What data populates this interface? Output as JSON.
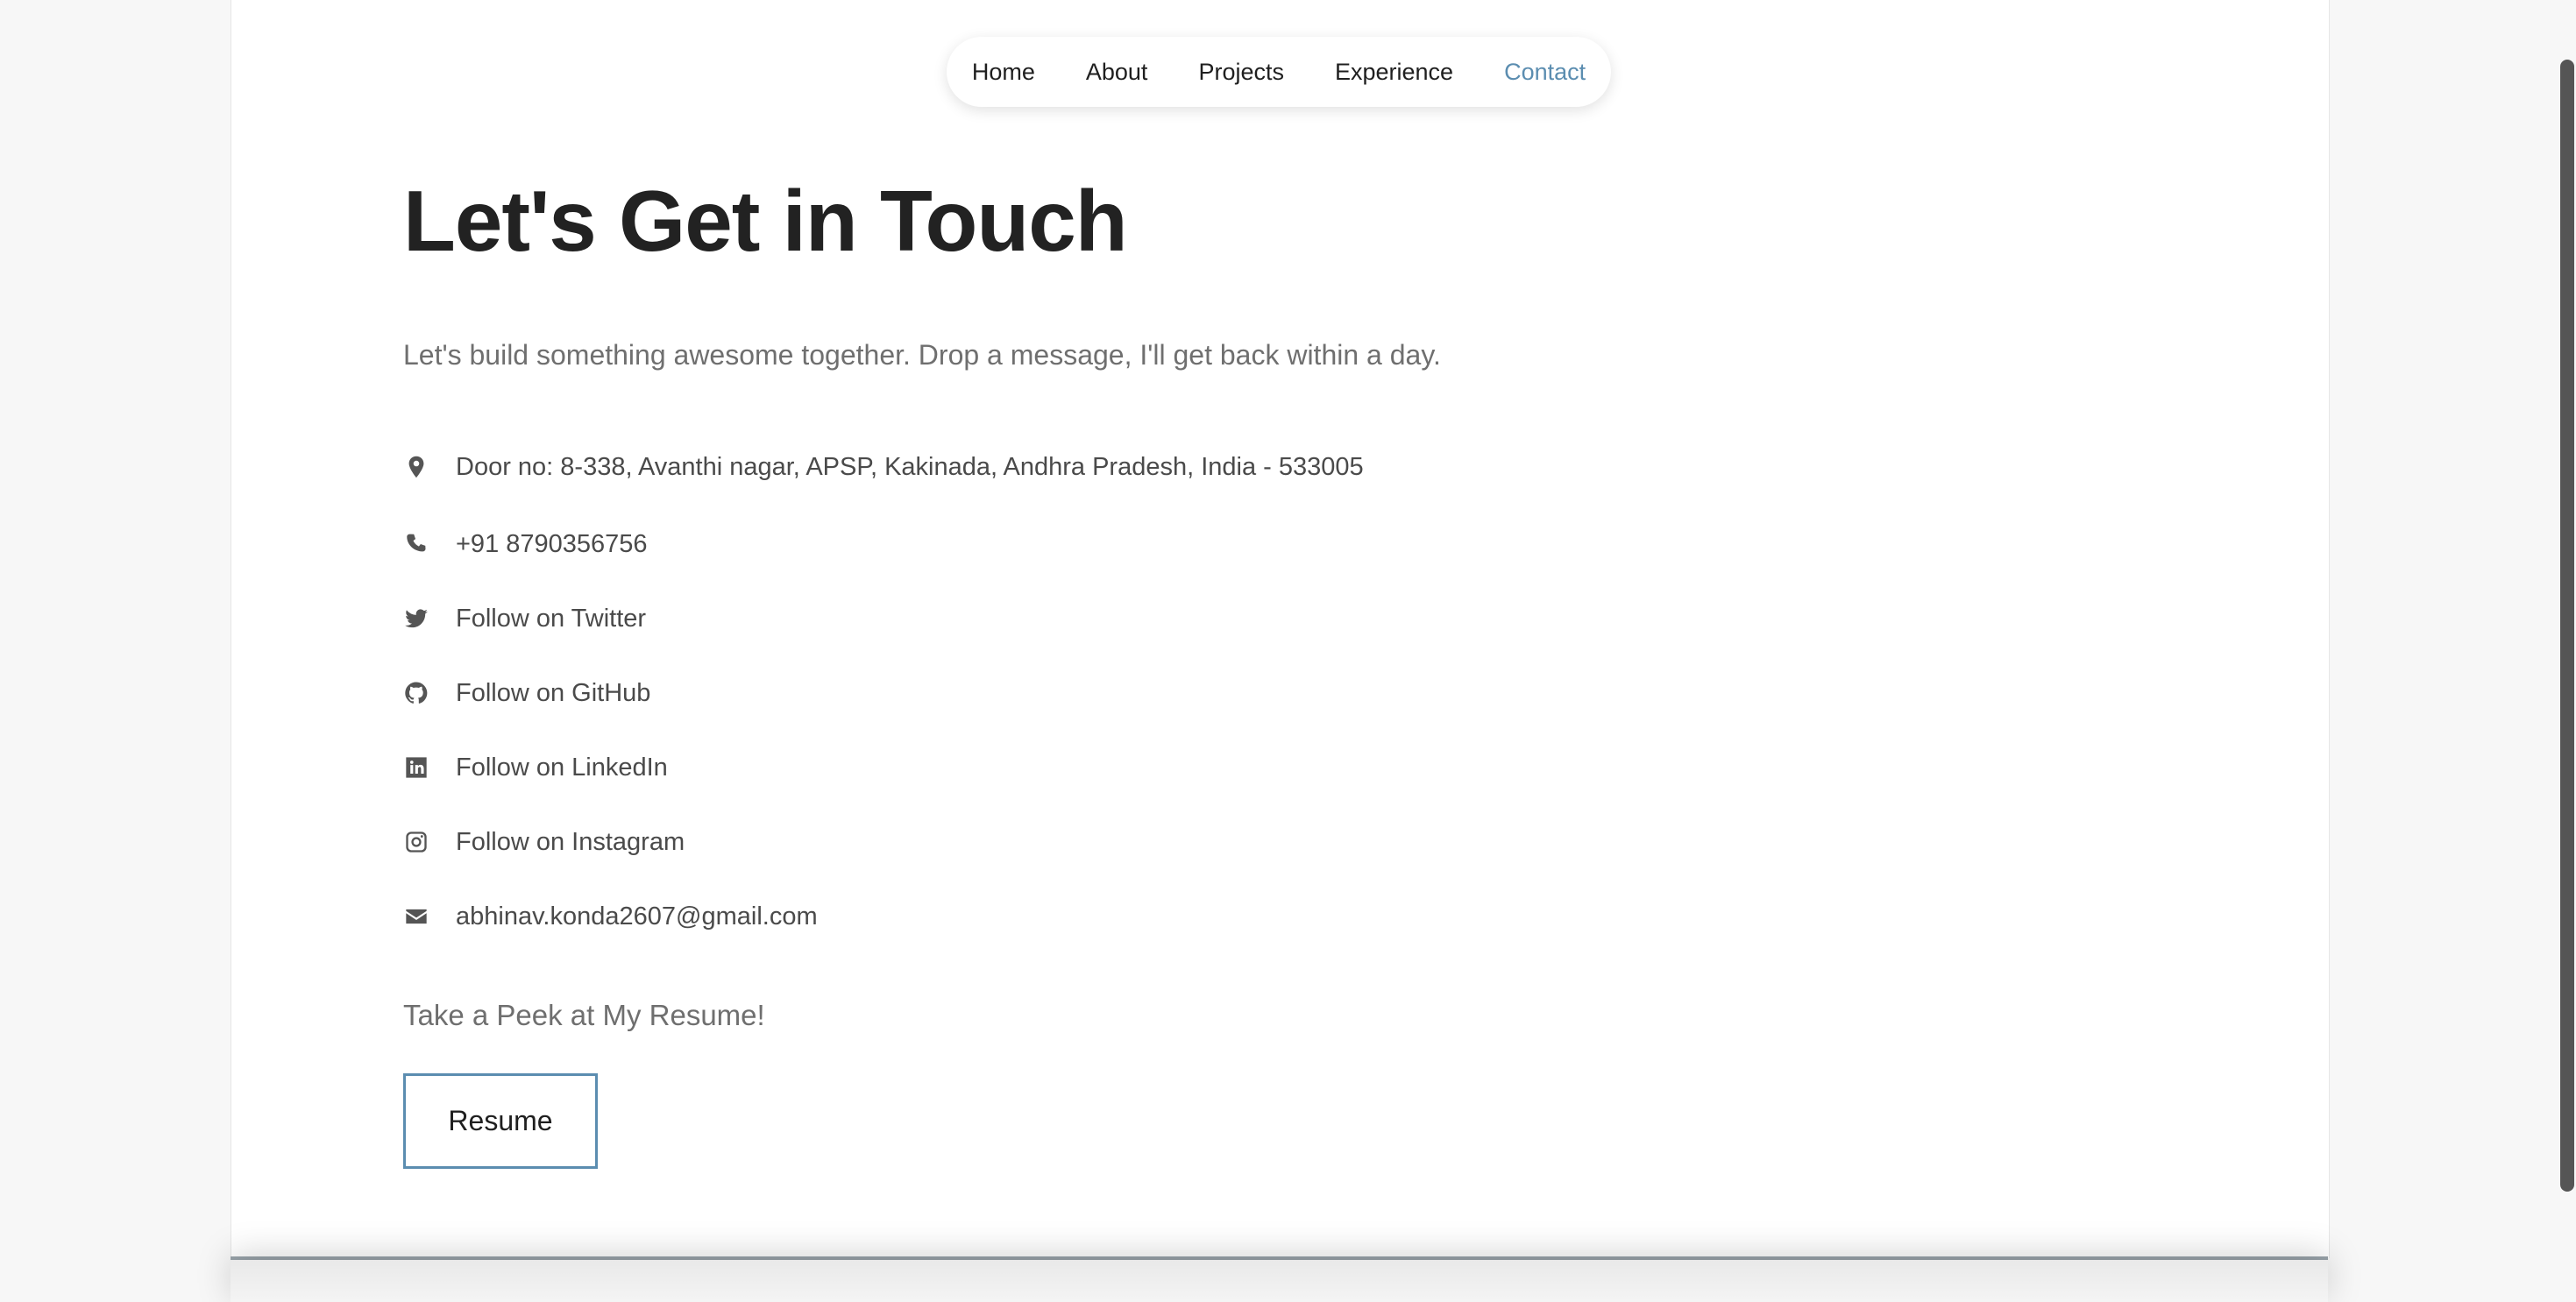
{
  "nav": {
    "items": [
      "Home",
      "About",
      "Projects",
      "Experience",
      "Contact"
    ],
    "active": "Contact"
  },
  "contact": {
    "title": "Let's Get in Touch",
    "subtitle": "Let's build something awesome together. Drop a message, I'll get back within a day.",
    "items": [
      {
        "icon": "location-pin-icon",
        "text": "Door no: 8-338, Avanthi nagar, APSP, Kakinada, Andhra Pradesh, India - 533005"
      },
      {
        "icon": "phone-icon",
        "text": "+91 8790356756"
      },
      {
        "icon": "twitter-icon",
        "text": "Follow on Twitter"
      },
      {
        "icon": "github-icon",
        "text": "Follow on GitHub"
      },
      {
        "icon": "linkedin-icon",
        "text": "Follow on LinkedIn"
      },
      {
        "icon": "instagram-icon",
        "text": "Follow on Instagram"
      },
      {
        "icon": "envelope-icon",
        "text": "abhinav.konda2607@gmail.com"
      }
    ],
    "resume_prompt": "Take a Peek at My Resume!",
    "resume_button": "Resume"
  },
  "colors": {
    "accent": "#5b8db0",
    "heading": "#222222",
    "muted": "#6f6f6f",
    "icon": "#555555"
  }
}
